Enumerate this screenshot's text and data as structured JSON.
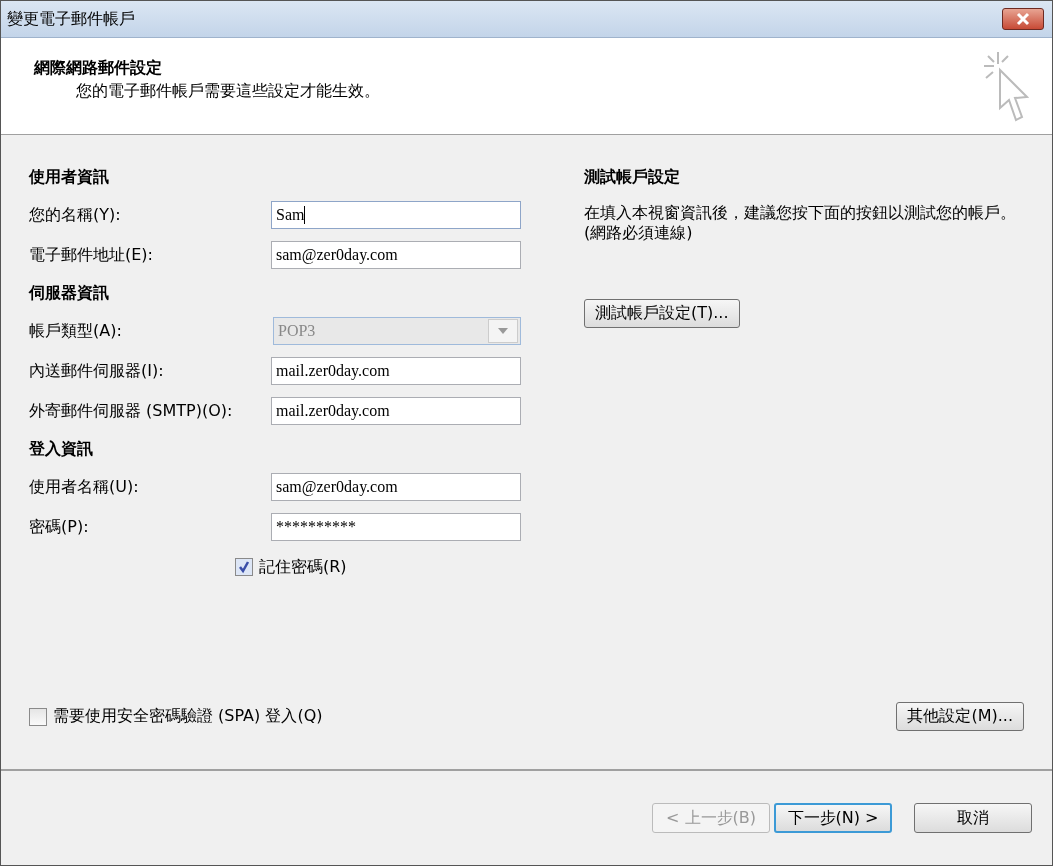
{
  "window": {
    "title": "變更電子郵件帳戶"
  },
  "header": {
    "title": "網際網路郵件設定",
    "subtitle": "您的電子郵件帳戶需要這些設定才能生效。"
  },
  "form": [
    {
      "kind": "heading",
      "label": "使用者資訊"
    },
    {
      "kind": "field",
      "label": "您的名稱(Y):",
      "value": "Sam",
      "focused": true
    },
    {
      "kind": "field",
      "label": "電子郵件地址(E):",
      "value": "sam@zer0day.com",
      "focused": false
    },
    {
      "kind": "heading",
      "label": "伺服器資訊"
    },
    {
      "kind": "dropdown",
      "label": "帳戶類型(A):",
      "value": "POP3",
      "disabled": true
    },
    {
      "kind": "field",
      "label": "內送郵件伺服器(I):",
      "value": "mail.zer0day.com",
      "focused": false
    },
    {
      "kind": "field",
      "label": "外寄郵件伺服器 (SMTP)(O):",
      "value": "mail.zer0day.com",
      "focused": false
    },
    {
      "kind": "heading",
      "label": "登入資訊"
    },
    {
      "kind": "field",
      "label": "使用者名稱(U):",
      "value": "sam@zer0day.com",
      "focused": false
    },
    {
      "kind": "field",
      "label": "密碼(P):",
      "value": "**********",
      "focused": false
    },
    {
      "kind": "checkbox",
      "label": "記住密碼(R)",
      "checked": true
    }
  ],
  "spa": {
    "label": "需要使用安全密碼驗證 (SPA) 登入(Q)",
    "checked": false
  },
  "test": {
    "title": "測試帳戶設定",
    "text": "在填入本視窗資訊後，建議您按下面的按鈕以測試您的帳戶。(網路必須連線)",
    "button": "測試帳戶設定(T)..."
  },
  "more_button": "其他設定(M)...",
  "footer_buttons": [
    {
      "label": "< 上一步(B)",
      "disabled": true,
      "default": false
    },
    {
      "label": "下一步(N) >",
      "disabled": false,
      "default": true
    },
    {
      "label": "取消",
      "disabled": false,
      "default": false
    }
  ]
}
